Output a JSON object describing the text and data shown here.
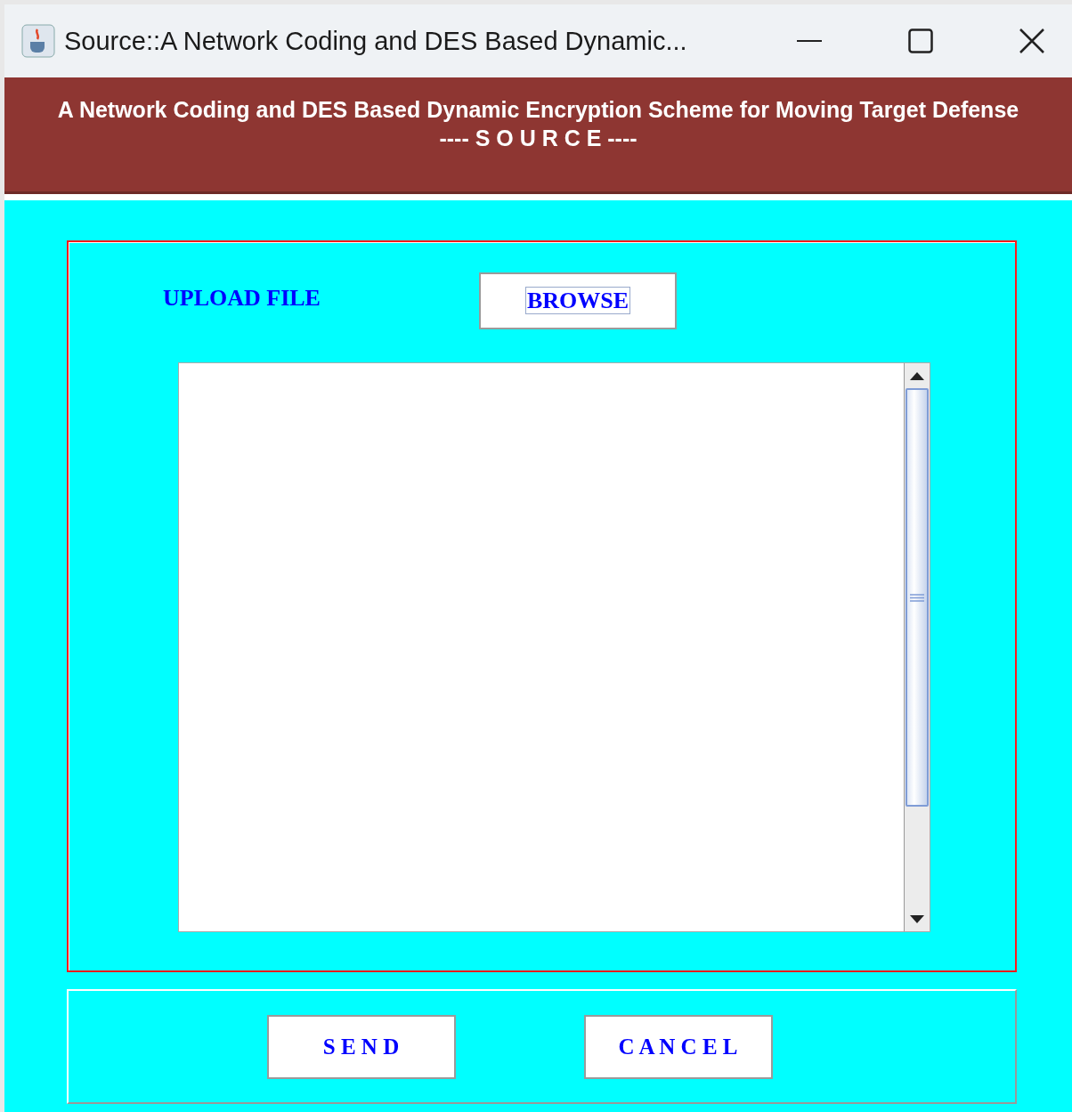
{
  "window": {
    "title": "Source::A Network Coding and DES Based Dynamic..."
  },
  "header": {
    "title": "A Network Coding and DES Based Dynamic Encryption Scheme for Moving Target Defense",
    "subtitle": "---- S O U R C E ----"
  },
  "upload": {
    "label": "UPLOAD FILE",
    "button": {
      "label": "BROWSE",
      "focused": true
    }
  },
  "buttons": [
    {
      "label": "S E N D"
    },
    {
      "label": "C A N C E L"
    }
  ]
}
